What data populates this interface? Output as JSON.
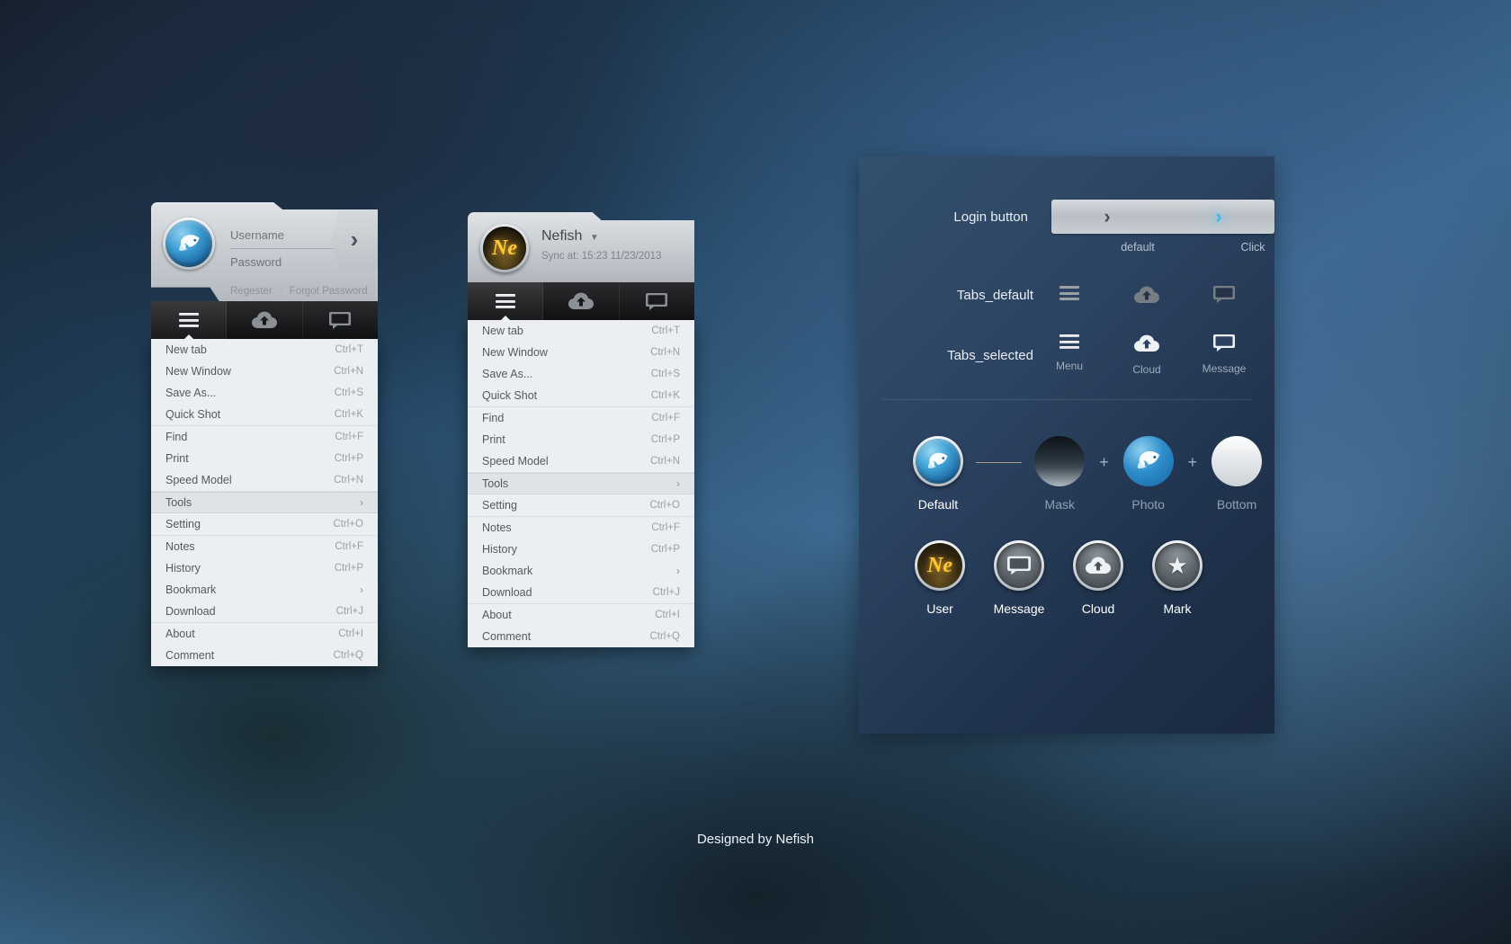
{
  "login_panel": {
    "username_placeholder": "Username",
    "password_placeholder": "Password",
    "register_label": "Regester",
    "separator": "|",
    "forgot_label": "Forgot Password",
    "go_icon": "chevron-right-icon",
    "avatar_icon": "fish-logo-icon"
  },
  "tabs": {
    "menu_icon": "hamburger-menu-icon",
    "cloud_icon": "cloud-upload-icon",
    "message_icon": "message-bubble-icon",
    "labels": {
      "menu": "Menu",
      "cloud": "Cloud",
      "message": "Message"
    }
  },
  "menu": {
    "groups": [
      {
        "items": [
          {
            "label": "New tab",
            "shortcut": "Ctrl+T"
          },
          {
            "label": "New Window",
            "shortcut": "Ctrl+N"
          },
          {
            "label": "Save As...",
            "shortcut": "Ctrl+S"
          },
          {
            "label": "Quick Shot",
            "shortcut": "Ctrl+K"
          }
        ]
      },
      {
        "items": [
          {
            "label": "Find",
            "shortcut": "Ctrl+F"
          },
          {
            "label": "Print",
            "shortcut": "Ctrl+P"
          },
          {
            "label": "Speed Model",
            "shortcut": "Ctrl+N"
          }
        ]
      },
      {
        "items": [
          {
            "label": "Tools",
            "shortcut": "",
            "submenu": true,
            "highlight": true
          },
          {
            "label": "Setting",
            "shortcut": "Ctrl+O"
          }
        ]
      },
      {
        "items": [
          {
            "label": "Notes",
            "shortcut": "Ctrl+F"
          },
          {
            "label": "History",
            "shortcut": "Ctrl+P"
          },
          {
            "label": "Bookmark",
            "shortcut": "",
            "submenu": true
          },
          {
            "label": "Download",
            "shortcut": "Ctrl+J"
          }
        ]
      },
      {
        "items": [
          {
            "label": "About",
            "shortcut": "Ctrl+I"
          },
          {
            "label": "Comment",
            "shortcut": "Ctrl+Q"
          }
        ]
      }
    ],
    "submenu_arrow": "chevron-right-icon"
  },
  "nefish_panel": {
    "title": "Nefish",
    "caret_icon": "caret-down-icon",
    "sync_text": "Sync at: 15:23 11/23/2013",
    "badge_text": "Ne"
  },
  "spec_panel": {
    "login_button": {
      "label": "Login button",
      "state_default": "default",
      "state_click": "Click",
      "chevron_icon": "chevron-right-icon"
    },
    "tabs_default_label": "Tabs_default",
    "tabs_selected_label": "Tabs_selected",
    "composition": {
      "result": "Default",
      "mask": "Mask",
      "photo": "Photo",
      "bottom": "Bottom",
      "plus": "+"
    },
    "icon_set": [
      {
        "label": "User",
        "icon": "user-ne-badge-icon"
      },
      {
        "label": "Message",
        "icon": "message-bubble-icon"
      },
      {
        "label": "Cloud",
        "icon": "cloud-upload-icon"
      },
      {
        "label": "Mark",
        "icon": "star-icon"
      }
    ]
  },
  "footer": {
    "credit": "Designed by Nefish"
  },
  "colors": {
    "accent_blue": "#3bb6f0",
    "badge_gold": "#ffc83c",
    "menu_bg": "#eceff1",
    "panel_bg": "#2b4260"
  }
}
